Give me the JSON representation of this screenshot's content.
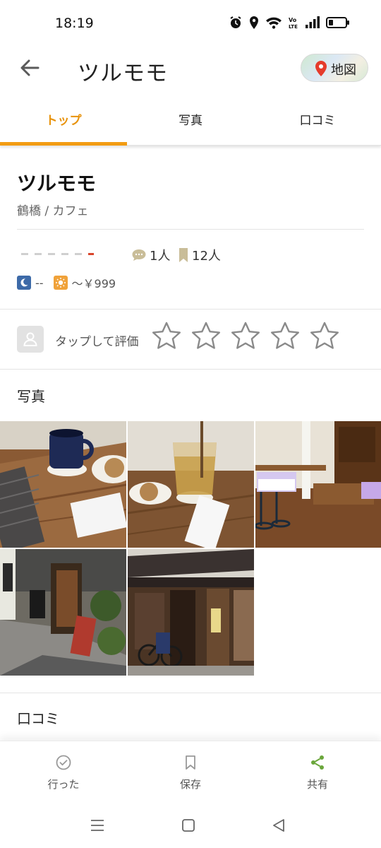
{
  "status_bar": {
    "time": "18:19",
    "icons": [
      "alarm-icon",
      "location-icon",
      "wifi-icon",
      "volte-icon",
      "signal-icon",
      "battery-icon"
    ]
  },
  "header": {
    "title": "ツルモモ",
    "map_button_label": "地図"
  },
  "tabs": [
    {
      "label": "トップ",
      "active": true
    },
    {
      "label": "写真",
      "active": false
    },
    {
      "label": "口コミ",
      "active": false
    }
  ],
  "shop": {
    "name": "ツルモモ",
    "area_category": "鶴橋 / カフェ",
    "review_count": "1人",
    "saved_count": "12人",
    "dinner_price": "--",
    "lunch_price": "～￥999"
  },
  "rate_prompt": {
    "label": "タップして評価",
    "star_count": 5
  },
  "photos_section": {
    "title": "写真",
    "photos": [
      {
        "name": "photo-coffee-cookie"
      },
      {
        "name": "photo-tea-cookie"
      },
      {
        "name": "photo-interior"
      },
      {
        "name": "photo-entrance"
      },
      {
        "name": "photo-storefront"
      }
    ]
  },
  "reviews_section": {
    "title": "口コミ"
  },
  "bottom_nav": {
    "items": [
      {
        "label": "行った",
        "icon": "check-badge-icon",
        "active": false
      },
      {
        "label": "保存",
        "icon": "bookmark-icon",
        "active": false
      },
      {
        "label": "共有",
        "icon": "share-icon",
        "active": true
      }
    ]
  },
  "colors": {
    "accent": "#f29c13",
    "share_green": "#6aa63b",
    "rating_red": "#d9452b"
  }
}
